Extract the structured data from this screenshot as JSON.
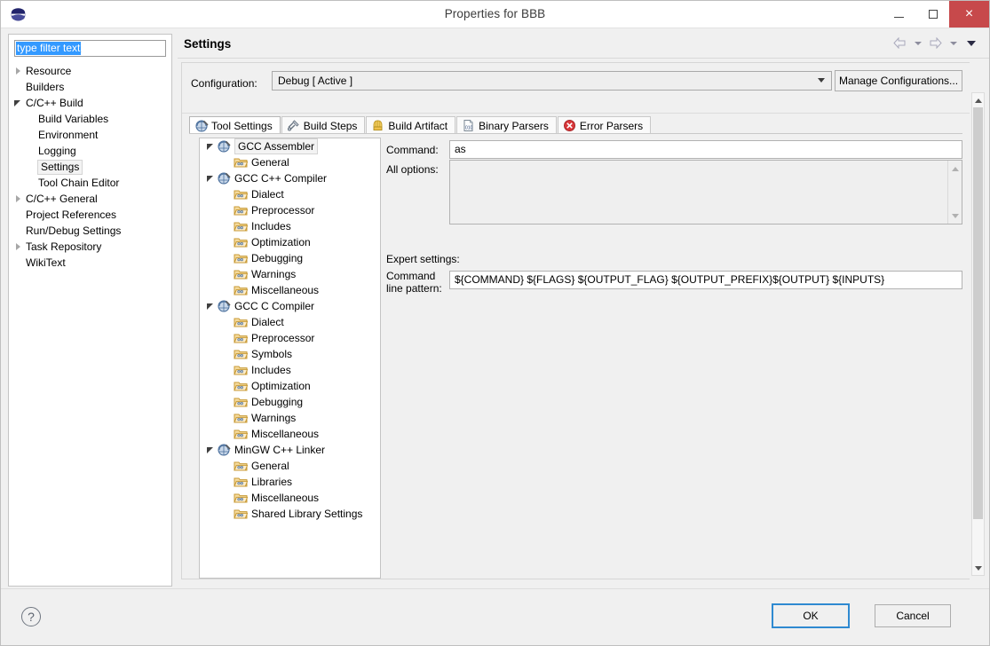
{
  "window": {
    "title": "Properties for BBB",
    "logo_icon": "eclipse-logo-icon",
    "minimize_label": "",
    "maximize_label": "",
    "close_label": "×"
  },
  "sidebar": {
    "filter": {
      "value": "type filter text",
      "placeholder": "type filter text",
      "selected": true
    },
    "items": [
      {
        "label": "Resource",
        "state": "collapsed",
        "indent": 0,
        "selected": false
      },
      {
        "label": "Builders",
        "state": "leaf",
        "indent": 0,
        "selected": false
      },
      {
        "label": "C/C++ Build",
        "state": "expanded",
        "indent": 0,
        "selected": false
      },
      {
        "label": "Build Variables",
        "state": "leaf",
        "indent": 1,
        "selected": false
      },
      {
        "label": "Environment",
        "state": "leaf",
        "indent": 1,
        "selected": false
      },
      {
        "label": "Logging",
        "state": "leaf",
        "indent": 1,
        "selected": false
      },
      {
        "label": "Settings",
        "state": "leaf",
        "indent": 1,
        "selected": true
      },
      {
        "label": "Tool Chain Editor",
        "state": "leaf",
        "indent": 1,
        "selected": false
      },
      {
        "label": "C/C++ General",
        "state": "collapsed",
        "indent": 0,
        "selected": false
      },
      {
        "label": "Project References",
        "state": "leaf",
        "indent": 0,
        "selected": false
      },
      {
        "label": "Run/Debug Settings",
        "state": "leaf",
        "indent": 0,
        "selected": false
      },
      {
        "label": "Task Repository",
        "state": "collapsed",
        "indent": 0,
        "selected": false
      },
      {
        "label": "WikiText",
        "state": "leaf",
        "indent": 0,
        "selected": false
      }
    ]
  },
  "header": {
    "title": "Settings",
    "back_icon": "back-arrow-icon",
    "back_dropdown_icon": "chevron-down-icon",
    "forward_icon": "forward-arrow-icon",
    "forward_dropdown_icon": "chevron-down-icon",
    "menu_icon": "chevron-down-icon"
  },
  "configuration": {
    "label": "Configuration:",
    "value": "Debug  [ Active ]",
    "dropdown_icon": "chevron-down-icon",
    "manage_button": "Manage Configurations..."
  },
  "tabs": [
    {
      "label": "Tool Settings",
      "icon": "wrench-icon",
      "active": true
    },
    {
      "label": "Build Steps",
      "icon": "hammer-icon",
      "active": false
    },
    {
      "label": "Build Artifact",
      "icon": "artifact-icon",
      "active": false
    },
    {
      "label": "Binary Parsers",
      "icon": "binary-file-icon",
      "active": false
    },
    {
      "label": "Error Parsers",
      "icon": "error-circle-icon",
      "active": false
    }
  ],
  "tool_tree": [
    {
      "label": "GCC Assembler",
      "type": "tool",
      "state": "expanded",
      "selected": true
    },
    {
      "label": "General",
      "type": "leaf",
      "state": "leaf",
      "selected": false
    },
    {
      "label": "GCC C++ Compiler",
      "type": "tool",
      "state": "expanded",
      "selected": false
    },
    {
      "label": "Dialect",
      "type": "leaf",
      "state": "leaf",
      "selected": false
    },
    {
      "label": "Preprocessor",
      "type": "leaf",
      "state": "leaf",
      "selected": false
    },
    {
      "label": "Includes",
      "type": "leaf",
      "state": "leaf",
      "selected": false
    },
    {
      "label": "Optimization",
      "type": "leaf",
      "state": "leaf",
      "selected": false
    },
    {
      "label": "Debugging",
      "type": "leaf",
      "state": "leaf",
      "selected": false
    },
    {
      "label": "Warnings",
      "type": "leaf",
      "state": "leaf",
      "selected": false
    },
    {
      "label": "Miscellaneous",
      "type": "leaf",
      "state": "leaf",
      "selected": false
    },
    {
      "label": "GCC C Compiler",
      "type": "tool",
      "state": "expanded",
      "selected": false
    },
    {
      "label": "Dialect",
      "type": "leaf",
      "state": "leaf",
      "selected": false
    },
    {
      "label": "Preprocessor",
      "type": "leaf",
      "state": "leaf",
      "selected": false
    },
    {
      "label": "Symbols",
      "type": "leaf",
      "state": "leaf",
      "selected": false
    },
    {
      "label": "Includes",
      "type": "leaf",
      "state": "leaf",
      "selected": false
    },
    {
      "label": "Optimization",
      "type": "leaf",
      "state": "leaf",
      "selected": false
    },
    {
      "label": "Debugging",
      "type": "leaf",
      "state": "leaf",
      "selected": false
    },
    {
      "label": "Warnings",
      "type": "leaf",
      "state": "leaf",
      "selected": false
    },
    {
      "label": "Miscellaneous",
      "type": "leaf",
      "state": "leaf",
      "selected": false
    },
    {
      "label": "MinGW C++ Linker",
      "type": "tool",
      "state": "expanded",
      "selected": false
    },
    {
      "label": "General",
      "type": "leaf",
      "state": "leaf",
      "selected": false
    },
    {
      "label": "Libraries",
      "type": "leaf",
      "state": "leaf",
      "selected": false
    },
    {
      "label": "Miscellaneous",
      "type": "leaf",
      "state": "leaf",
      "selected": false
    },
    {
      "label": "Shared Library Settings",
      "type": "leaf",
      "state": "leaf",
      "selected": false
    }
  ],
  "form": {
    "command_label": "Command:",
    "command_value": "as",
    "all_options_label": "All options:",
    "all_options_value": "",
    "expert_label": "Expert settings:",
    "command_line_pattern_label_line1": "Command",
    "command_line_pattern_label_line2": "line pattern:",
    "command_line_pattern_value": "${COMMAND} ${FLAGS} ${OUTPUT_FLAG} ${OUTPUT_PREFIX}${OUTPUT} ${INPUTS}"
  },
  "footer": {
    "help_icon": "question-mark-icon",
    "ok_label": "OK",
    "cancel_label": "Cancel"
  },
  "colors": {
    "close_button": "#c7494b",
    "selection_blue": "#3399ff",
    "focus_border": "#2f8ad1",
    "panel_bg": "#f0f0f0",
    "tool_icon": "#6f8fbe",
    "folder_icon": "#e8b552"
  }
}
